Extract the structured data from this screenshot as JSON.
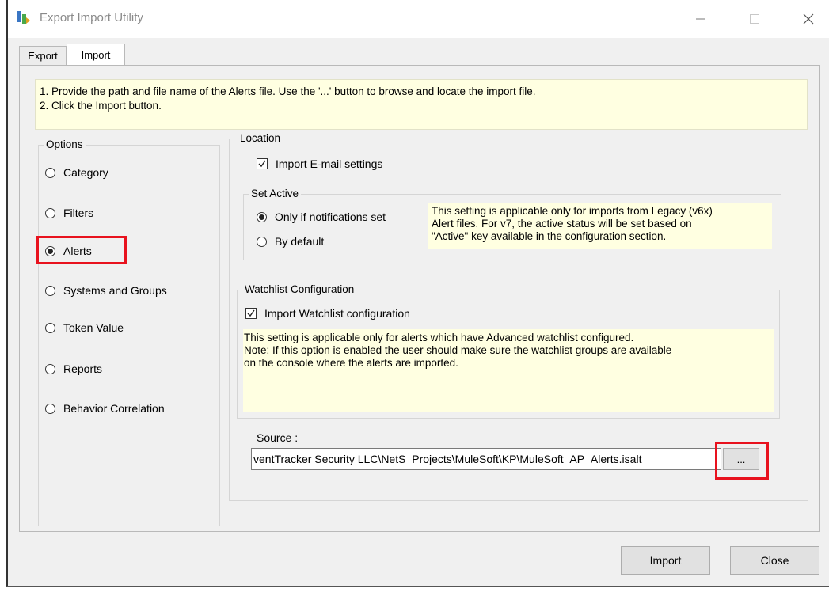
{
  "window": {
    "title": "Export Import Utility",
    "controls": {
      "minimize_icon": "minimize-icon",
      "maximize_icon": "maximize-icon",
      "close_icon": "close-icon"
    }
  },
  "tabs": [
    {
      "label": "Export",
      "selected": false
    },
    {
      "label": "Import",
      "selected": true
    }
  ],
  "instructions": {
    "line1": "1. Provide the path and file name of the Alerts file. Use the '...' button to browse and locate the import file.",
    "line2": "2. Click the Import button."
  },
  "options": {
    "label": "Options",
    "selected": "Alerts",
    "items": [
      {
        "label": "Category",
        "checked": false
      },
      {
        "label": "Filters",
        "checked": false
      },
      {
        "label": "Alerts",
        "checked": true
      },
      {
        "label": "Systems and Groups",
        "checked": false
      },
      {
        "label": "Token Value",
        "checked": false
      },
      {
        "label": "Reports",
        "checked": false
      },
      {
        "label": "Behavior Correlation",
        "checked": false
      }
    ]
  },
  "location": {
    "label": "Location",
    "import_email": {
      "label": "Import E-mail settings",
      "checked": true
    },
    "set_active": {
      "label": "Set Active",
      "options": [
        {
          "label": "Only if notifications set",
          "checked": true
        },
        {
          "label": "By default",
          "checked": false
        }
      ],
      "note_lines": [
        "This setting is applicable only for imports from Legacy (v6x)",
        "Alert files. For v7, the active status will be set based on",
        "\"Active\" key available in the configuration section."
      ]
    },
    "watchlist": {
      "label": "Watchlist Configuration",
      "import_watchlist": {
        "label": "Import Watchlist configuration",
        "checked": true
      },
      "note_lines": [
        "This setting is applicable only for alerts which have Advanced watchlist configured.",
        "Note: If this option is enabled the user should make sure the watchlist groups are available",
        "on the console where the alerts are imported."
      ]
    },
    "source": {
      "label": "Source :",
      "value": "ventTracker Security LLC\\NetS_Projects\\MuleSoft\\KP\\MuleSoft_AP_Alerts.isalt",
      "browse_label": "..."
    }
  },
  "buttons": {
    "import": "Import",
    "close": "Close"
  },
  "colors": {
    "highlight": "#e8121e",
    "note_bg": "#ffffe1",
    "dialog_bg": "#f0f0f0"
  }
}
